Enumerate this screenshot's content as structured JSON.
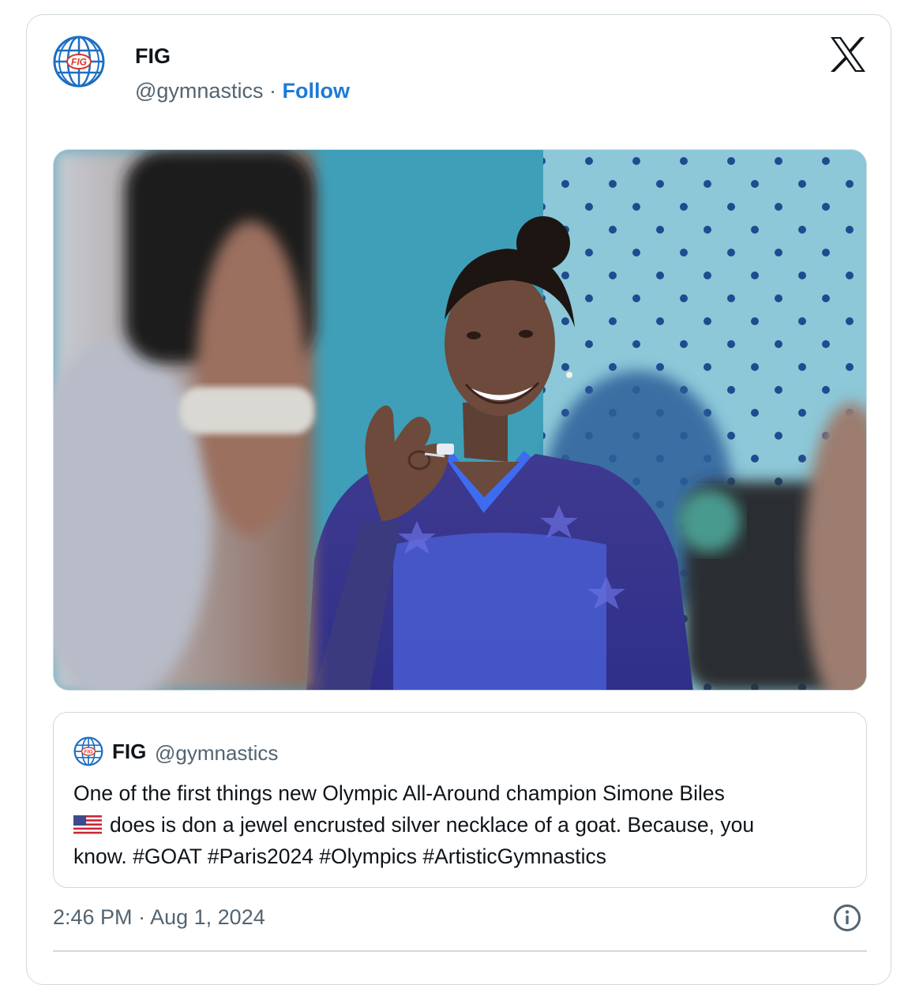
{
  "account": {
    "name": "FIG",
    "handle": "@gymnastics",
    "separator": "·",
    "follow_label": "Follow",
    "logo_icon": "fig-globe-logo"
  },
  "platform_icon": "x-logo-icon",
  "quoted_post": {
    "name": "FIG",
    "handle": "@gymnastics",
    "text_lines": [
      "One of the first things new Olympic All-Around champion Simone Biles",
      "does is don a jewel encrusted silver necklace of a goat. Because, you",
      "know. #GOAT #Paris2024 #Olympics #ArtisticGymnastics"
    ],
    "flag_icon": "us-flag-emoji"
  },
  "timestamp": {
    "time": "2:46 PM",
    "separator": "·",
    "date": "Aug 1, 2024"
  },
  "colors": {
    "follow": "#1d7bd6",
    "secondary_text": "#536471",
    "border": "#cfd9de",
    "logo_blue": "#1d6fc2",
    "logo_red": "#d4382c"
  }
}
